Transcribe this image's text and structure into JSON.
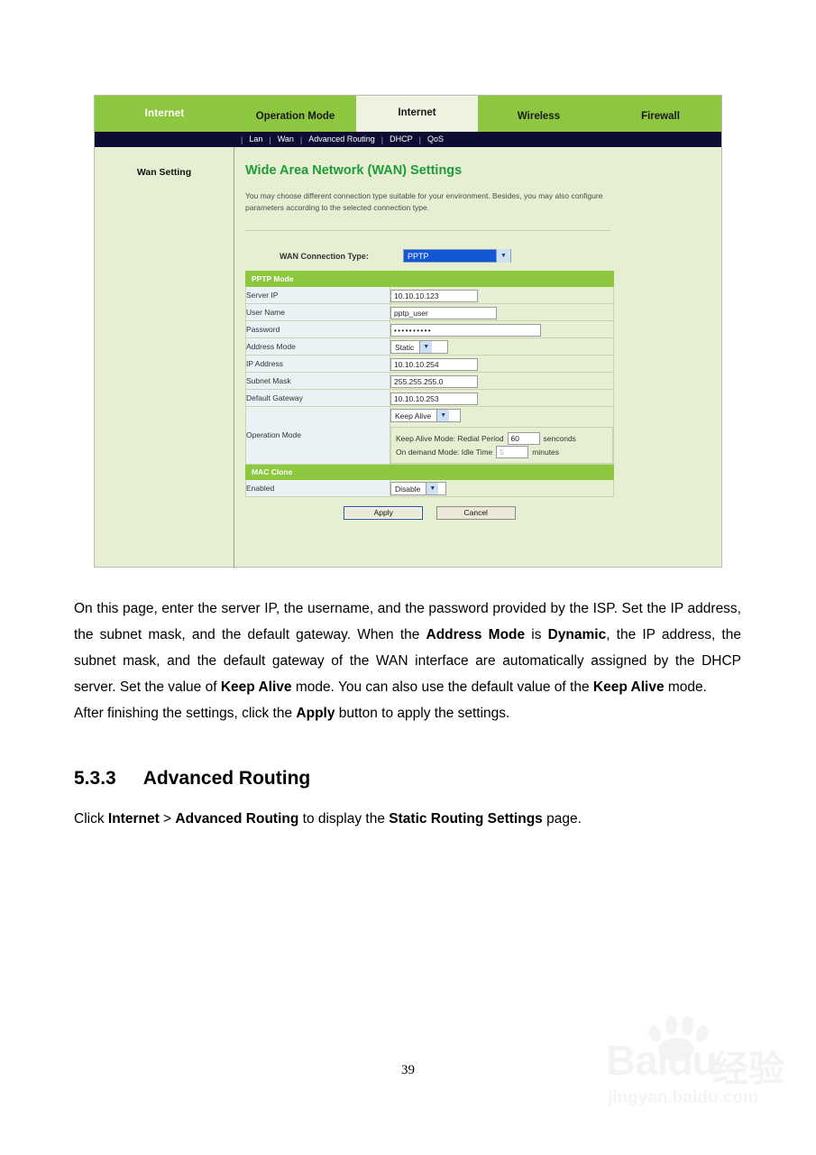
{
  "figure": {
    "brand_label": "Internet",
    "main_tabs": [
      {
        "label": "Operation Mode",
        "active": false
      },
      {
        "label": "Internet",
        "active": true
      },
      {
        "label": "Wireless",
        "active": false
      },
      {
        "label": "Firewall",
        "active": false
      }
    ],
    "sub_nav": [
      "Lan",
      "Wan",
      "Advanced Routing",
      "DHCP",
      "QoS"
    ],
    "sidebar_title": "Wan Setting",
    "panel": {
      "title": "Wide Area Network (WAN) Settings",
      "description": "You may choose different connection type suitable for your environment. Besides, you may also configure parameters according to the selected connection type."
    },
    "connection_type": {
      "label": "WAN Connection Type:",
      "value": "PPTP"
    },
    "pptp_section_title": "PPTP Mode",
    "fields": [
      {
        "label": "Server IP",
        "value": "10.10.10.123"
      },
      {
        "label": "User Name",
        "value": "pptp_user"
      },
      {
        "label": "Password",
        "value": "••••••••••"
      },
      {
        "label": "Address Mode",
        "value": "Static"
      },
      {
        "label": "IP Address",
        "value": "10.10.10.254"
      },
      {
        "label": "Subnet Mask",
        "value": "255.255.255.0"
      },
      {
        "label": "Default Gateway",
        "value": "10.10.10.253"
      }
    ],
    "operation_mode": {
      "label": "Operation Mode",
      "select_value": "Keep Alive",
      "keep_alive_prefix": "Keep Alive Mode: Redial Period",
      "keep_alive_value": "60",
      "keep_alive_unit": "senconds",
      "on_demand_prefix": "On demand Mode: Idle Time",
      "on_demand_value": "5",
      "on_demand_unit": "minutes"
    },
    "mac_clone": {
      "section_title": "MAC Clone",
      "label": "Enabled",
      "value": "Disable"
    },
    "buttons": {
      "apply": "Apply",
      "cancel": "Cancel"
    },
    "colors": {
      "green_header": "#8dc63f",
      "panel_bg": "#e7efd2",
      "subnav_bg": "#0d0d33",
      "title_green": "#1f9c3a",
      "label_bg": "#e9f3f6",
      "select_highlight": "#1457d6"
    }
  },
  "document": {
    "paragraph_1": {
      "seg1": "On this page, enter the server IP, the username, and the password provided by the ISP. Set the IP address, the subnet mask, and the default gateway. When the ",
      "b1": "Address Mode",
      "seg2": " is ",
      "b2": "Dynamic",
      "seg3": ", the IP address, the subnet mask, and the default gateway of the WAN interface are automatically assigned by the DHCP server. Set the value of ",
      "b3": "Keep Alive",
      "seg4": " mode. You can also use the default value of the ",
      "b4": "Keep Alive",
      "seg5": " mode."
    },
    "paragraph_2": {
      "seg1": "After finishing the settings, click the ",
      "b1": "Apply",
      "seg2": " button to apply the settings."
    },
    "heading": {
      "number": "5.3.3",
      "text": "Advanced Routing"
    },
    "paragraph_3": {
      "seg1": "Click ",
      "b1": "Internet",
      "seg2": " > ",
      "b2": "Advanced Routing",
      "seg3": " to display the ",
      "b3": "Static Routing Settings",
      "seg4": " page."
    },
    "page_number": "39"
  },
  "watermark": {
    "brand": "Baidu",
    "cn": "经验",
    "url": "jingyan.baidu.com"
  }
}
